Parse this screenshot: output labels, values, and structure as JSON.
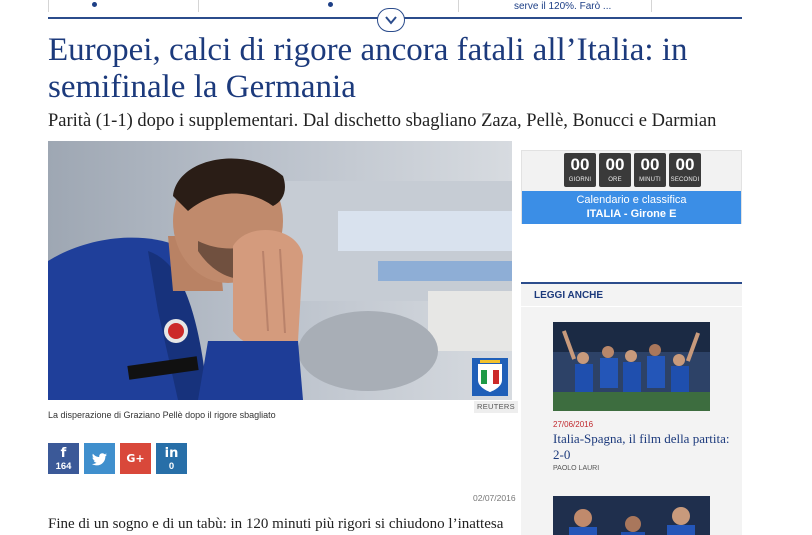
{
  "nav": {
    "teaser": "serve il 120%. Farò ..."
  },
  "article": {
    "title": "Europei, calci di rigore ancora fatali all’Italia: in semifinale la Germania",
    "subtitle": "Parità (1-1) dopo i supplementari. Dal dischetto sbagliano Zaza, Pellè, Bonucci e Darmian",
    "photo_credit": "REUTERS",
    "caption": "La disperazione di Graziano Pellè dopo il rigore sbagliato",
    "date": "02/07/2016",
    "body_first_line": "Fine di un sogno e di un tabù: in 120 minuti più rigori si chiudono l’inattesa"
  },
  "share": {
    "facebook": {
      "icon": "f",
      "count": "164"
    },
    "twitter": {
      "icon": "twitter-bird-icon"
    },
    "googleplus": {
      "icon": "G+"
    },
    "linkedin": {
      "icon": "in",
      "count": "0"
    }
  },
  "countdown": {
    "days": {
      "value": "00",
      "label": "GIORNI"
    },
    "hours": {
      "value": "00",
      "label": "ORE"
    },
    "minutes": {
      "value": "00",
      "label": "MINUTI"
    },
    "seconds": {
      "value": "00",
      "label": "SECONDI"
    },
    "calendar_line1": "Calendario e classifica",
    "calendar_line2": "ITALIA - Girone E"
  },
  "related": {
    "heading": "LEGGI ANCHE",
    "items": [
      {
        "date": "27/06/2016",
        "title": "Italia-Spagna, il film della partita: 2-0",
        "author": "PAOLO LAURI"
      }
    ]
  },
  "colors": {
    "accent": "#1c3a7c",
    "calendar_blue": "#3b8ee6",
    "facebook": "#3b5998",
    "twitter": "#3f8fcd",
    "googleplus": "#d9483a",
    "linkedin": "#286fa8",
    "date_red": "#c0282d"
  }
}
